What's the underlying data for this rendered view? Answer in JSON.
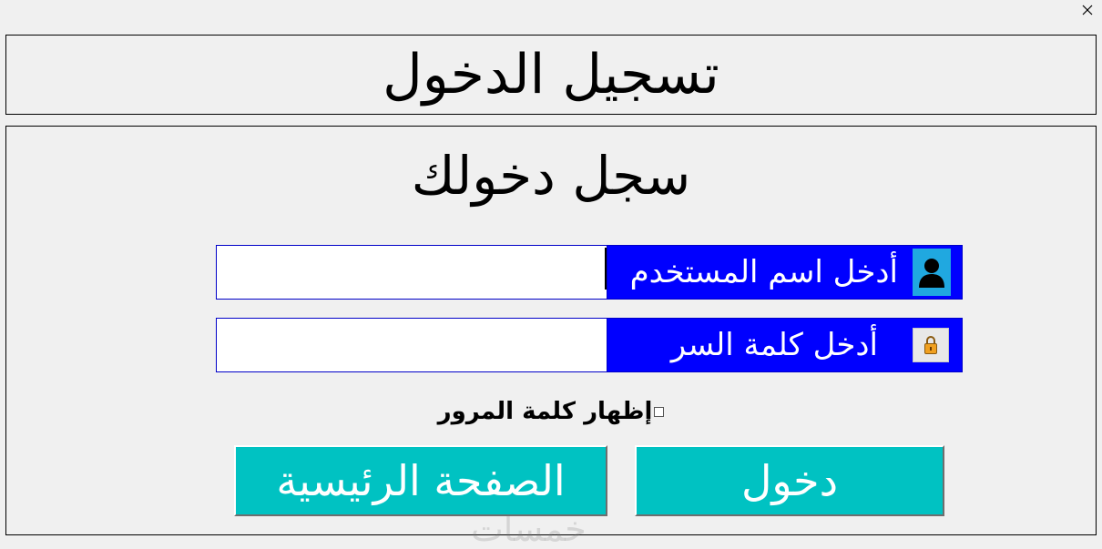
{
  "window": {
    "close_icon": "close-icon"
  },
  "title_panel": {
    "title": "تسجيل الدخول"
  },
  "form": {
    "heading": "سجل دخولك",
    "username": {
      "label": "أدخل اسم المستخدم",
      "icon": "user-icon",
      "value": ""
    },
    "password": {
      "label": "أدخل كلمة السر",
      "icon": "lock-icon",
      "value": ""
    },
    "show_password": {
      "label": "إظهار كلمة المرور",
      "checked": false
    },
    "login_button": "دخول",
    "home_button": "الصفحة الرئيسية"
  },
  "watermark": "خمسات",
  "colors": {
    "label_bg": "#0000ff",
    "button_bg": "#00c2c2",
    "user_icon_bg": "#20a8e0"
  }
}
